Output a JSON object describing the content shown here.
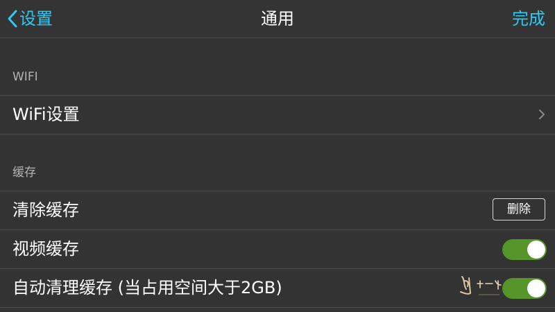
{
  "nav": {
    "back_label": "设置",
    "title": "通用",
    "done_label": "完成",
    "accent_color": "#2fc9f1"
  },
  "sections": {
    "wifi": {
      "header": "WIFI",
      "settings_label": "WiFi设置"
    },
    "cache": {
      "header": "缓存",
      "clear_label": "清除缓存",
      "delete_button_label": "删除",
      "video_cache_label": "视频缓存",
      "video_cache_enabled": true,
      "auto_clean_label": "自动清理缓存 (当占用空间大于2GB)",
      "auto_clean_enabled": true
    }
  },
  "colors": {
    "background": "#333333",
    "toggle_on": "#55952a",
    "divider": "#4c4c4c"
  },
  "icons": {
    "back": "chevron-left-icon",
    "disclosure": "chevron-right-icon"
  }
}
